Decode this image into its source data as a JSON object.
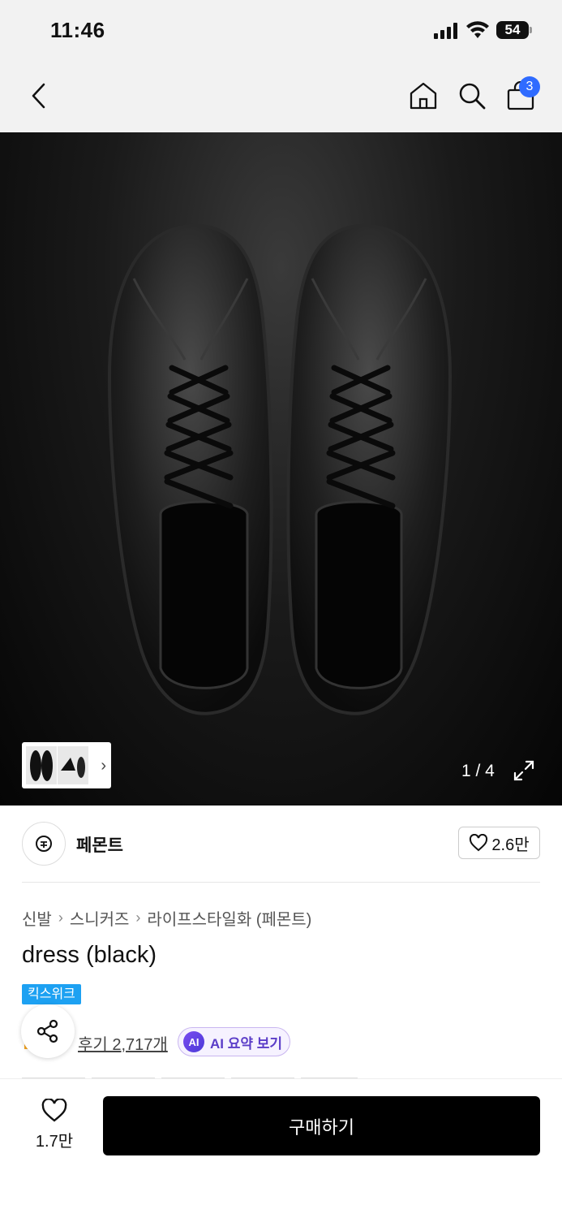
{
  "status_bar": {
    "time": "11:46",
    "battery": "54"
  },
  "nav": {
    "back_icon": "chevron-left-icon",
    "home_icon": "home-icon",
    "search_icon": "search-icon",
    "bag_icon": "shopping-bag-icon",
    "cart_count": "3"
  },
  "gallery": {
    "counter": "1 / 4",
    "expand_icon": "expand-icon"
  },
  "brand": {
    "name": "페몬트",
    "favorite_count": "2.6만"
  },
  "breadcrumb": [
    "신발",
    "스니커즈",
    "라이프스타일화 (페몬트)"
  ],
  "product": {
    "title": "dress (black)",
    "tag": "킥스위크",
    "review_link": "후기 2,717개",
    "ai_badge": "AI",
    "ai_summary": "AI 요약 보기"
  },
  "bottom_bar": {
    "like_count": "1.7만",
    "buy_label": "구매하기"
  },
  "colors": {
    "accent_blue": "#2f6bff",
    "tag_blue": "#1da1f2",
    "ai_purple": "#5b3dc8",
    "buy_button": "#000000"
  }
}
